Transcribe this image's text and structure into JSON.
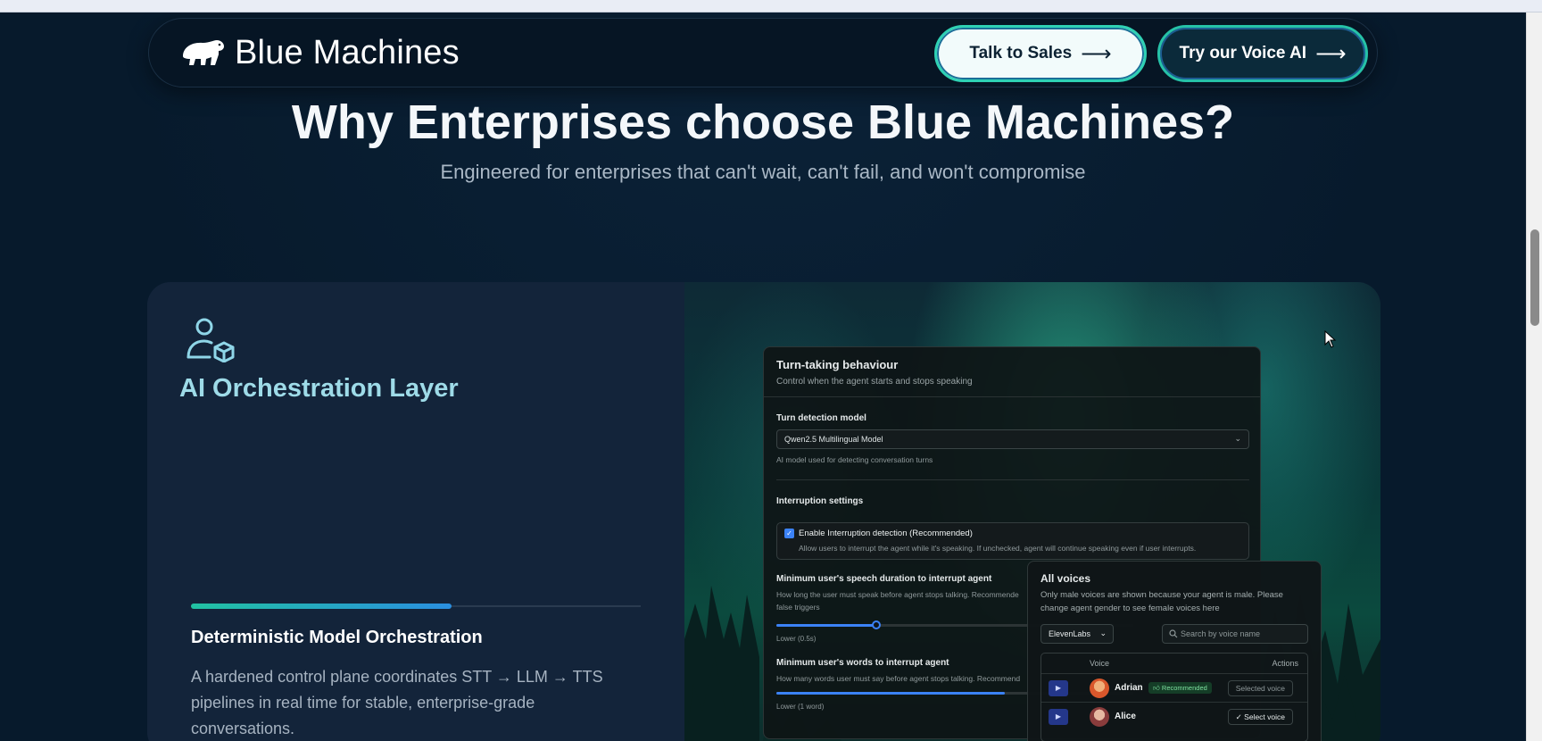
{
  "nav": {
    "brand": "Blue Machines",
    "talk_to_sales": "Talk to Sales",
    "try_voice_ai": "Try our Voice AI",
    "arrow": "⟶"
  },
  "hero": {
    "title": "Why Enterprises choose Blue Machines?",
    "subtitle": "Engineered for enterprises that can't wait, can't fail, and won't compromise"
  },
  "feature": {
    "icon": "user-cube-icon",
    "title": "AI Orchestration Layer",
    "progress": 0.58,
    "item_title": "Deterministic Model Orchestration",
    "item_description": "A hardened control plane coordinates STT → LLM → TTS pipelines in real time for stable, enterprise-grade conversations."
  },
  "turn_panel": {
    "title": "Turn-taking behaviour",
    "subtitle": "Control when the agent starts and stops speaking",
    "detection_label": "Turn detection model",
    "detection_value": "Qwen2.5 Multilingual Model",
    "detection_help": "AI model used for detecting conversation turns",
    "interruption_label": "Interruption settings",
    "enable_label": "Enable Interruption detection (Recommended)",
    "enable_help": "Allow users to interrupt the agent while it's speaking. If unchecked, agent will continue speaking even if user interrupts.",
    "min_duration_label": "Minimum user's speech duration to interrupt agent",
    "min_duration_help_1": "How long the user must speak before agent stops talking. Recommende",
    "min_duration_help_2": "false triggers",
    "min_duration_value": "Lower (0.5s)",
    "min_duration_level": 0.28,
    "min_words_label": "Minimum user's words to interrupt agent",
    "min_words_help": "How many words user must say before agent stops talking. Recommend",
    "min_words_value": "Lower (1 word)",
    "min_words_level": 0.64
  },
  "voices_panel": {
    "title": "All voices",
    "subtitle": "Only male voices are shown because your agent is male. Please change agent gender to see female voices here",
    "provider": "ElevenLabs",
    "search_placeholder": "Search by voice name",
    "col_voice": "Voice",
    "col_actions": "Actions",
    "rows": [
      {
        "name": "Adrian",
        "badge": "Recommended",
        "action": "Selected voice"
      },
      {
        "name": "Alice",
        "badge": "",
        "action": "Select voice"
      }
    ]
  },
  "colors": {
    "accent_teal": "#2fd1b4",
    "accent_blue": "#2a8fe0",
    "background": "#071a2c"
  }
}
